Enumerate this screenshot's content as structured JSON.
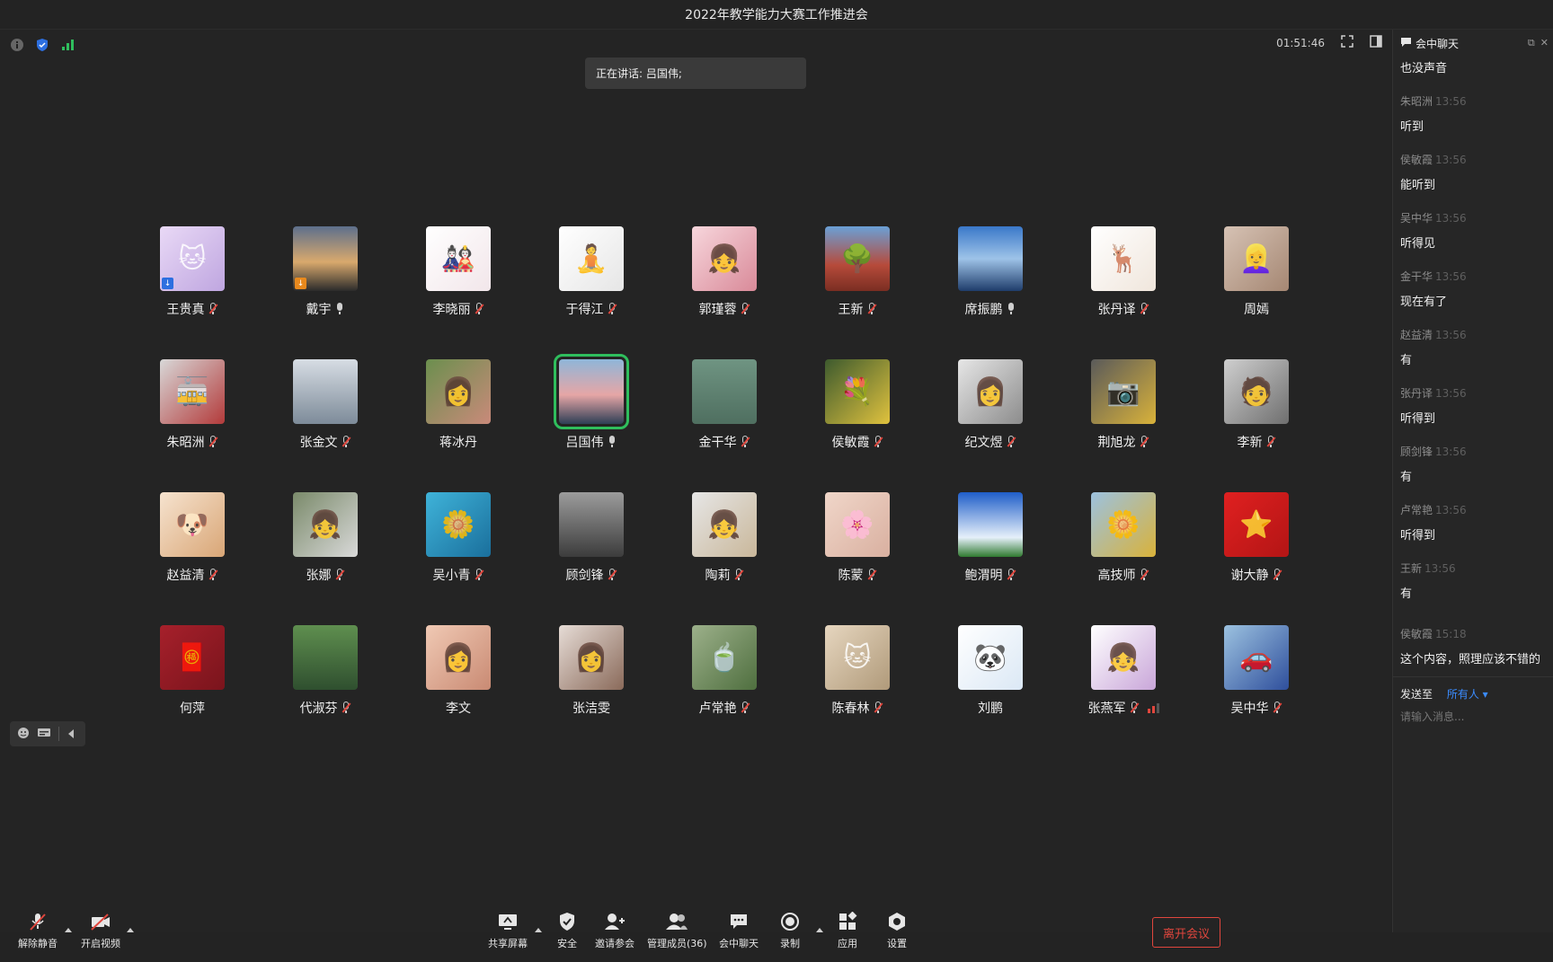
{
  "window": {
    "title": "2022年教学能力大赛工作推进会"
  },
  "topbar": {
    "timer": "01:51:46"
  },
  "speaking": {
    "text": "正在讲话: 吕国伟;"
  },
  "colors": {
    "accent": "#2fbe5d",
    "danger": "#e0463d",
    "link": "#3b8cff"
  },
  "participants": [
    {
      "name": "王贵真",
      "mic": "muted",
      "badge": "blue",
      "bg": "linear-gradient(135deg,#e9d9f6,#bfa6e0)",
      "glyph": "🐱"
    },
    {
      "name": "戴宇",
      "mic": "on",
      "badge": "orange",
      "bg": "linear-gradient(180deg,#5d6f8c,#d9a96d 55%,#2b2b2b)",
      "glyph": ""
    },
    {
      "name": "李晓丽",
      "mic": "muted",
      "badge": "",
      "bg": "linear-gradient(135deg,#ffffff,#f2e6ea)",
      "glyph": "🎎"
    },
    {
      "name": "于得江",
      "mic": "muted",
      "badge": "",
      "bg": "linear-gradient(135deg,#ffffff,#e6e6e6)",
      "glyph": "🧘"
    },
    {
      "name": "郭瑾蓉",
      "mic": "muted",
      "badge": "",
      "bg": "linear-gradient(135deg,#f7d6dc,#d98a99)",
      "glyph": "👧"
    },
    {
      "name": "王新",
      "mic": "muted",
      "badge": "",
      "bg": "linear-gradient(180deg,#6aa0d6,#b64a3a 60%,#7a2e22)",
      "glyph": "🌳"
    },
    {
      "name": "席振鹏",
      "mic": "on",
      "badge": "",
      "bg": "linear-gradient(180deg,#3a78c9,#9ec3e8 50%,#1f3d6b)",
      "glyph": ""
    },
    {
      "name": "张丹译",
      "mic": "muted",
      "badge": "",
      "bg": "linear-gradient(135deg,#ffffff,#f0e6dc)",
      "glyph": "🦌"
    },
    {
      "name": "周嫣",
      "mic": "none",
      "badge": "",
      "bg": "linear-gradient(135deg,#d6c2b4,#a58773)",
      "glyph": "👱‍♀️"
    },
    {
      "name": "朱昭洲",
      "mic": "muted",
      "badge": "",
      "bg": "linear-gradient(135deg,#d8d8d8,#b33a3a)",
      "glyph": "🚋"
    },
    {
      "name": "张金文",
      "mic": "muted",
      "badge": "",
      "bg": "linear-gradient(180deg,#d7dde4,#7d8b99)",
      "glyph": ""
    },
    {
      "name": "蒋冰丹",
      "mic": "none",
      "badge": "",
      "bg": "linear-gradient(135deg,#6b8f4e,#c98a7a)",
      "glyph": "👩"
    },
    {
      "name": "吕国伟",
      "mic": "on",
      "badge": "",
      "bg": "linear-gradient(180deg,#8fb6d9,#e6a6a6 55%,#2e3e55)",
      "glyph": "",
      "active": true
    },
    {
      "name": "金干华",
      "mic": "muted",
      "badge": "",
      "bg": "linear-gradient(180deg,#6f9482,#4f6f60)",
      "glyph": ""
    },
    {
      "name": "侯敏霞",
      "mic": "muted",
      "badge": "",
      "bg": "linear-gradient(135deg,#3d5a2e,#e0c23e)",
      "glyph": "💐"
    },
    {
      "name": "纪文煜",
      "mic": "muted",
      "badge": "",
      "bg": "linear-gradient(135deg,#e6e6e6,#8c8c8c)",
      "glyph": "👩"
    },
    {
      "name": "荆旭龙",
      "mic": "muted",
      "badge": "",
      "bg": "linear-gradient(135deg,#5a5a5a,#d9b23a)",
      "glyph": "📷"
    },
    {
      "name": "李新",
      "mic": "muted",
      "badge": "",
      "bg": "linear-gradient(135deg,#cfcfcf,#6f6f6f)",
      "glyph": "🧑"
    },
    {
      "name": "赵益清",
      "mic": "muted",
      "badge": "",
      "bg": "linear-gradient(135deg,#f6e3cf,#d9a676)",
      "glyph": "🐶"
    },
    {
      "name": "张娜",
      "mic": "muted",
      "badge": "",
      "bg": "linear-gradient(135deg,#7a8a6a,#d9d9d9)",
      "glyph": "👧"
    },
    {
      "name": "吴小青",
      "mic": "muted",
      "badge": "",
      "bg": "linear-gradient(135deg,#3fb3d9,#1a6f9c)",
      "glyph": "🌼"
    },
    {
      "name": "顾剑锋",
      "mic": "muted",
      "badge": "",
      "bg": "linear-gradient(180deg,#9c9c9c,#3c3c3c)",
      "glyph": ""
    },
    {
      "name": "陶莉",
      "mic": "muted",
      "badge": "",
      "bg": "linear-gradient(135deg,#e6e6e6,#c9b79a)",
      "glyph": "👧"
    },
    {
      "name": "陈蒙",
      "mic": "muted",
      "badge": "",
      "bg": "linear-gradient(135deg,#f0d6c9,#d9b0a0)",
      "glyph": "🌸"
    },
    {
      "name": "鲍渭明",
      "mic": "muted",
      "badge": "",
      "bg": "linear-gradient(180deg,#1f5ec9,#e6f0fa 70%,#2f7a2f)",
      "glyph": ""
    },
    {
      "name": "高技师",
      "mic": "muted",
      "badge": "",
      "bg": "linear-gradient(135deg,#9cc2e0,#d9b23a)",
      "glyph": "🌼"
    },
    {
      "name": "谢大静",
      "mic": "muted",
      "badge": "",
      "bg": "linear-gradient(135deg,#e02020,#b31515)",
      "glyph": "⭐"
    },
    {
      "name": "何萍",
      "mic": "none",
      "badge": "",
      "bg": "linear-gradient(135deg,#a6202b,#7a141c)",
      "glyph": "🧧"
    },
    {
      "name": "代淑芬",
      "mic": "muted",
      "badge": "",
      "bg": "linear-gradient(180deg,#5f8f4f,#2f4f2f)",
      "glyph": ""
    },
    {
      "name": "李文",
      "mic": "none",
      "badge": "",
      "bg": "linear-gradient(135deg,#f0c9b4,#c98a73)",
      "glyph": "👩"
    },
    {
      "name": "张洁雯",
      "mic": "none",
      "badge": "",
      "bg": "linear-gradient(135deg,#e6dcd6,#8a6a5a)",
      "glyph": "👩"
    },
    {
      "name": "卢常艳",
      "mic": "muted",
      "badge": "",
      "bg": "linear-gradient(135deg,#9cb08a,#4f6f3f)",
      "glyph": "🍵"
    },
    {
      "name": "陈春林",
      "mic": "muted",
      "badge": "",
      "bg": "linear-gradient(135deg,#e6d6bf,#b09a7a)",
      "glyph": "🐱"
    },
    {
      "name": "刘鹏",
      "mic": "none",
      "badge": "",
      "bg": "linear-gradient(135deg,#ffffff,#dbe8f5)",
      "glyph": "🐼"
    },
    {
      "name": "张燕军",
      "mic": "muted",
      "badge": "",
      "bg": "linear-gradient(135deg,#ffffff,#c9a6d9)",
      "glyph": "👧",
      "signal": true
    },
    {
      "name": "吴中华",
      "mic": "muted",
      "badge": "",
      "bg": "linear-gradient(135deg,#9cc2e0,#2f4f9c)",
      "glyph": "🚗"
    }
  ],
  "toolbar": {
    "unmute": "解除静音",
    "video": "开启视频",
    "share": "共享屏幕",
    "security": "安全",
    "invite": "邀请参会",
    "members": "管理成员(36)",
    "chat": "会中聊天",
    "record": "录制",
    "apps": "应用",
    "settings": "设置",
    "leave": "离开会议"
  },
  "chat": {
    "title": "会中聊天",
    "first_text": "也没声音",
    "messages": [
      {
        "sender": "朱昭洲",
        "time": "13:56",
        "text": "听到"
      },
      {
        "sender": "侯敏霞",
        "time": "13:56",
        "text": "能听到"
      },
      {
        "sender": "吴中华",
        "time": "13:56",
        "text": "听得见"
      },
      {
        "sender": "金干华",
        "time": "13:56",
        "text": "现在有了"
      },
      {
        "sender": "赵益清",
        "time": "13:56",
        "text": "有"
      },
      {
        "sender": "张丹译",
        "time": "13:56",
        "text": "听得到"
      },
      {
        "sender": "顾剑锋",
        "time": "13:56",
        "text": "有"
      },
      {
        "sender": "卢常艳",
        "time": "13:56",
        "text": "听得到"
      },
      {
        "sender": "王新",
        "time": "13:56",
        "text": "有"
      },
      {
        "sender": "侯敏霞",
        "time": "15:18",
        "text": "这个内容，照理应该不错的"
      }
    ],
    "send_to_label": "发送至",
    "send_to_target": "所有人",
    "placeholder": "请输入消息..."
  }
}
